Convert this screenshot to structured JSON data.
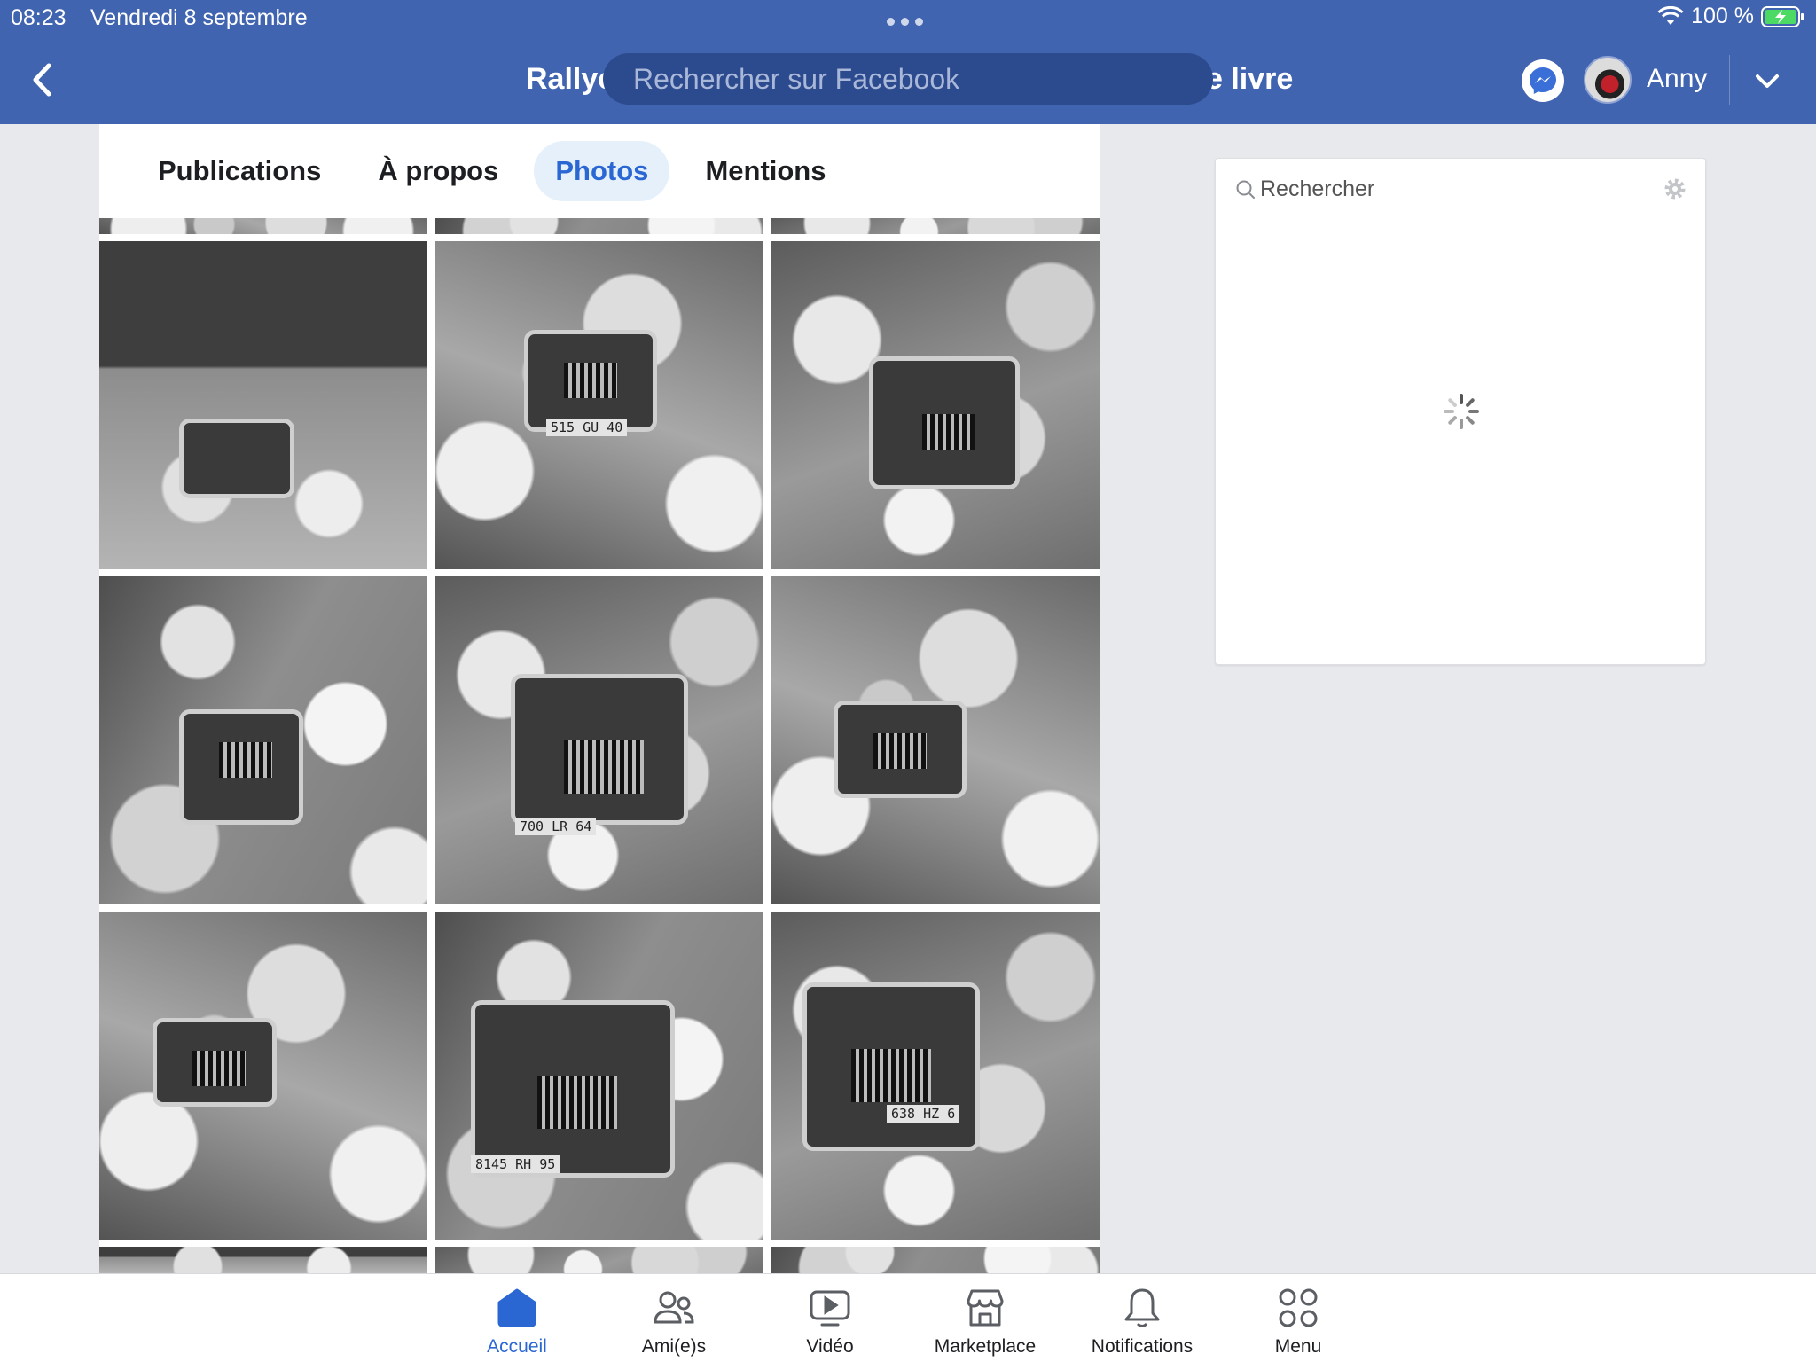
{
  "status_bar": {
    "time": "08:23",
    "date": "Vendredi 8 septembre",
    "battery": "100 %"
  },
  "header": {
    "title_left": "Rallye",
    "title_right": "e livre",
    "search_placeholder": "Rechercher sur Facebook",
    "user_name": "Anny",
    "brand_color": "#4064b0"
  },
  "tabs": [
    {
      "label": "Publications",
      "active": false
    },
    {
      "label": "À propos",
      "active": false
    },
    {
      "label": "Photos",
      "active": true
    },
    {
      "label": "Mentions",
      "active": false
    }
  ],
  "photo_plates": [
    {
      "row": 1,
      "col": 2,
      "text": "515 GU 40"
    },
    {
      "row": 2,
      "col": 2,
      "text": "700 LR 64"
    },
    {
      "row": 3,
      "col": 2,
      "text": "8145 RH 95"
    },
    {
      "row": 3,
      "col": 3,
      "text": "638 HZ 6"
    }
  ],
  "sidebar": {
    "search_placeholder": "Rechercher"
  },
  "bottom_nav": [
    {
      "label": "Accueil",
      "icon": "home-icon",
      "active": true
    },
    {
      "label": "Ami(e)s",
      "icon": "friends-icon",
      "active": false
    },
    {
      "label": "Vidéo",
      "icon": "video-icon",
      "active": false
    },
    {
      "label": "Marketplace",
      "icon": "marketplace-icon",
      "active": false
    },
    {
      "label": "Notifications",
      "icon": "bell-icon",
      "active": false
    },
    {
      "label": "Menu",
      "icon": "menu-grid-icon",
      "active": false
    }
  ],
  "colors": {
    "accent": "#2a67d2",
    "active_tab_bg": "#e6f0fb"
  }
}
